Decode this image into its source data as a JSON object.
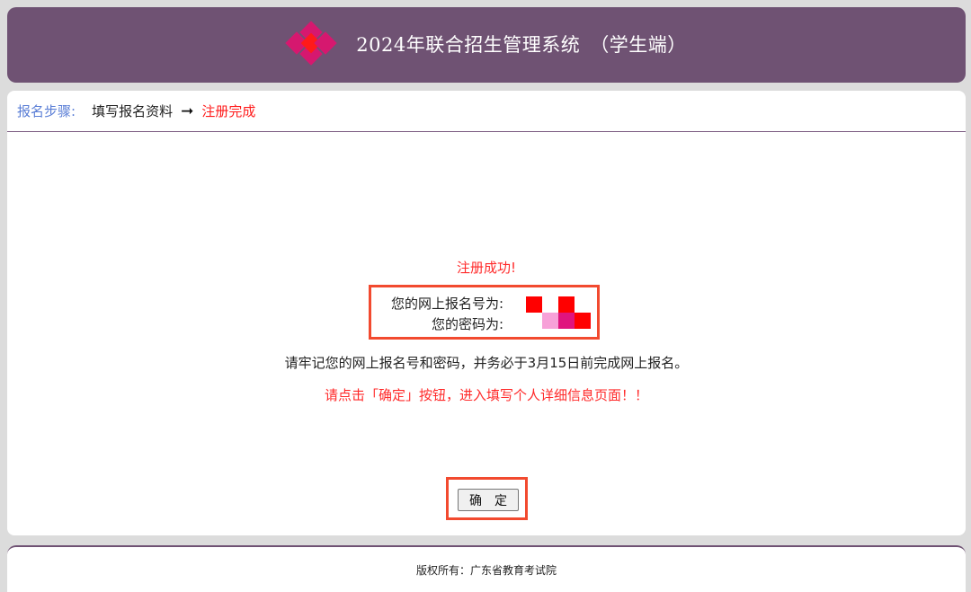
{
  "header": {
    "title": "2024年联合招生管理系统　（学生端）",
    "logo_colors": [
      "#d6186f",
      "#ff1a1a",
      "#d6186f",
      "#d6186f"
    ]
  },
  "steps": {
    "label": "报名步骤:",
    "items": [
      {
        "label": "填写报名资料",
        "state": "done"
      },
      {
        "label": "注册完成",
        "state": "current"
      }
    ],
    "arrow": "➞"
  },
  "result": {
    "success_message": "注册成功!",
    "registration_label": "您的网上报名号为:",
    "password_label": "您的密码为:",
    "note": "请牢记您的网上报名号和密码，并务必于3月15日前完成网上报名。",
    "notice": "请点击「确定」按钮，进入填写个人详细信息页面！！"
  },
  "confirm_button": {
    "label": "确　定"
  },
  "footer": {
    "copyright": "版权所有：广东省教育考试院"
  },
  "colors": {
    "header_bg": "#6f5273",
    "accent_red": "#ff1a1a",
    "step_label": "#5a7ed6",
    "highlight_box": "#f24a2f"
  }
}
